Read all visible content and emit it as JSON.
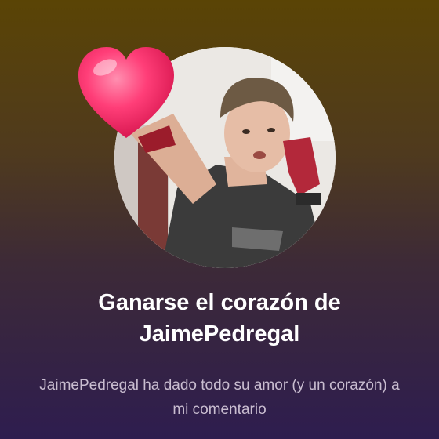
{
  "notification": {
    "title": "Ganarse el corazón de JaimePedregal",
    "message": "JaimePedregal ha dado todo su amor (y un corazón) a mi comentario",
    "avatar_icon": "profile-photo",
    "heart_icon": "heart-icon"
  },
  "colors": {
    "heart": "#ff2f6d",
    "title": "#ffffff",
    "message": "#c9bdd0",
    "bg_top": "#5a4405",
    "bg_bottom": "#2e1d4f"
  }
}
